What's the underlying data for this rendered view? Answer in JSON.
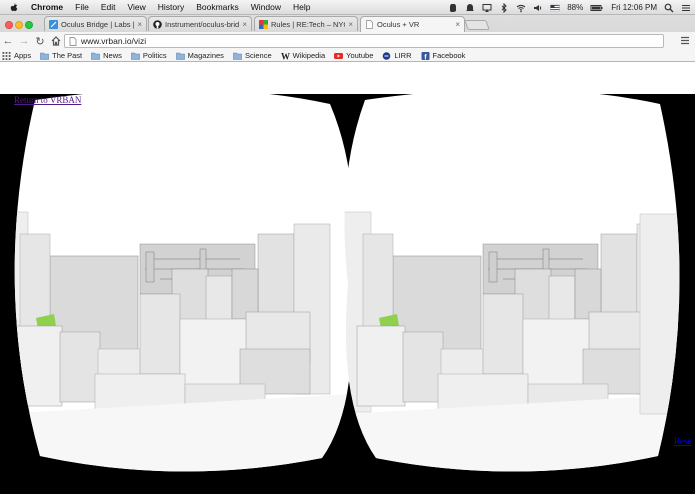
{
  "menubar": {
    "app_name": "Chrome",
    "menus": [
      "File",
      "Edit",
      "View",
      "History",
      "Bookmarks",
      "Window",
      "Help"
    ],
    "battery": "88%",
    "clock": "Fri 12:06 PM",
    "status_icons": [
      "evernote-icon",
      "bell-icon",
      "airplay-icon",
      "bluetooth-icon",
      "wifi-icon",
      "volume-icon",
      "flag-icon",
      "battery-icon",
      "search-icon",
      "list-icon"
    ]
  },
  "tabs": [
    {
      "title": "Oculus Bridge | Labs | Inst",
      "icon": "labs-favicon"
    },
    {
      "title": "Instrument/oculus-bridge",
      "icon": "github-favicon"
    },
    {
      "title": "Rules | RE:Tech – NYC Rea",
      "icon": "retech-favicon"
    },
    {
      "title": "Oculus + VR",
      "icon": "page-favicon",
      "active": true
    }
  ],
  "toolbar": {
    "url": "www.vrban.io/vizi"
  },
  "bookmarks": [
    {
      "label": "Apps",
      "icon": "apps-grid-icon"
    },
    {
      "label": "The Past",
      "icon": "folder-icon"
    },
    {
      "label": "News",
      "icon": "folder-icon"
    },
    {
      "label": "Politics",
      "icon": "folder-icon"
    },
    {
      "label": "Magazines",
      "icon": "folder-icon"
    },
    {
      "label": "Science",
      "icon": "folder-icon"
    },
    {
      "label": "Wikipedia",
      "icon": "wikipedia-icon"
    },
    {
      "label": "Youtube",
      "icon": "youtube-icon"
    },
    {
      "label": "LIRR",
      "icon": "lirr-icon"
    },
    {
      "label": "Facebook",
      "icon": "facebook-icon"
    }
  ],
  "page": {
    "return_link": "Return to VRBAN",
    "corner_link": "Rese"
  },
  "colors": {
    "menubar_bg": "#e8e8e8",
    "tab_active_bg": "#f5f5f5",
    "vr_background": "#000000",
    "link_visited": "#551a8b",
    "link": "#0000ee",
    "building_face": "#dcdcdc",
    "grass": "#8fd14f"
  }
}
